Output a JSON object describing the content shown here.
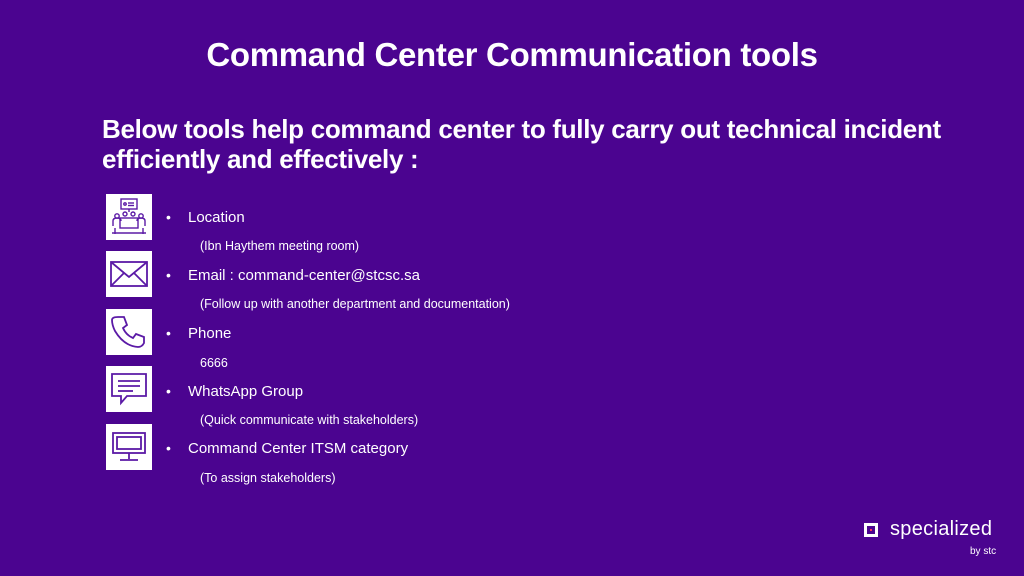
{
  "title": "Command Center Communication tools",
  "subtitle_line1": "Below tools help command center to fully carry out technical incident",
  "subtitle_line2": "efficiently and effectively :",
  "tools": [
    {
      "icon": "meeting-room-icon",
      "label": "Location",
      "detail": "(Ibn Haythem meeting room)"
    },
    {
      "icon": "email-icon",
      "label": "Email : command-center@stcsc.sa",
      "detail": "(Follow up with another department and documentation)"
    },
    {
      "icon": "phone-icon",
      "label": "Phone",
      "detail": "6666"
    },
    {
      "icon": "chat-icon",
      "label": "WhatsApp Group",
      "detail": "(Quick communicate with stakeholders)"
    },
    {
      "icon": "monitor-icon",
      "label": "Command Center ITSM category",
      "detail": "(To assign stakeholders)"
    }
  ],
  "brand": {
    "name": "specialized",
    "by": "by stc"
  },
  "colors": {
    "background": "#4b0490",
    "icon": "#5b1aa6",
    "accent": "#ff375e"
  }
}
